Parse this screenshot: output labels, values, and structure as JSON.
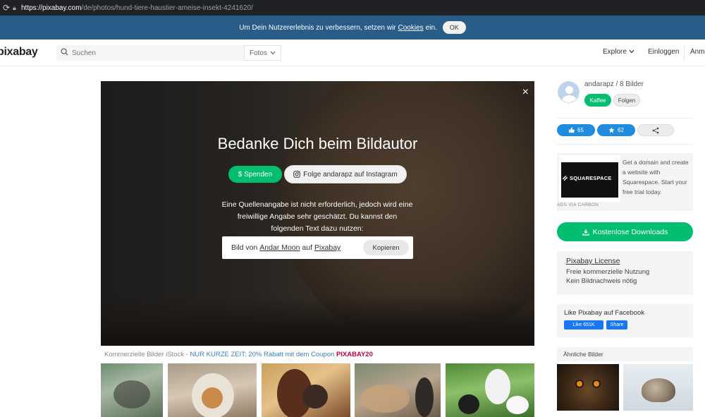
{
  "browser": {
    "url_host": "https://pixabay.com",
    "url_path": "/de/photos/hund-tiere-haustier-ameise-insekt-4241620/"
  },
  "cookie_bar": {
    "text_before": "Um Dein Nutzererlebnis zu verbessern, setzen wir",
    "link": "Cookies",
    "text_after": "ein.",
    "ok_label": "OK"
  },
  "header": {
    "logo": "pixabay",
    "search_placeholder": "Suchen",
    "filter_label": "Fotos",
    "explore_label": "Explore",
    "login_label": "Einloggen",
    "register_label": "Anm"
  },
  "photo_overlay": {
    "title": "Bedanke Dich beim Bildautor",
    "donate_label": "$ Spenden",
    "instagram_label": "Folge andarapz auf Instagram",
    "description": "Eine Quellenangabe ist nicht erforderlich, jedoch wird eine freiwillige Angabe sehr geschätzt. Du kannst den folgenden Text dazu nutzen:",
    "credit_prefix": "Bild von",
    "credit_author": "Andar Moon",
    "credit_mid": "auf",
    "credit_site": "Pixabay",
    "copy_label": "Kopieren",
    "close_symbol": "×"
  },
  "promo": {
    "prefix": "Kommerzielle Bilder iStock -",
    "deal": "NUR KURZE ZEIT: 20% Rabatt mit dem Coupon",
    "code": "PIXABAY20"
  },
  "sidebar": {
    "author_line": "andarapz / 8 Bilder",
    "coffee_label": "Kaffee",
    "follow_label": "Folgen",
    "likes": "65",
    "favorites": "62",
    "ad": {
      "brand": "SQUARESPACE",
      "text": "Get a domain and create a website with Squarespace. Start your free trial today.",
      "via": "ADS VIA CARBON"
    },
    "download_label": "Kostenlose Downloads",
    "license": {
      "title": "Pixabay License",
      "line1": "Freie kommerzielle Nutzung",
      "line2": "Kein Bildnachweis nötig"
    },
    "facebook": {
      "title": "Like Pixabay auf Facebook",
      "like_label": "Like 651K",
      "share_label": "Share"
    },
    "similar_title": "Ähnliche Bilder"
  },
  "colors": {
    "brand_green": "#02be6e",
    "cookie_bar_blue": "#2a5c8a",
    "like_blue": "#1f8ce0",
    "promo_code_red": "#c0003a"
  }
}
